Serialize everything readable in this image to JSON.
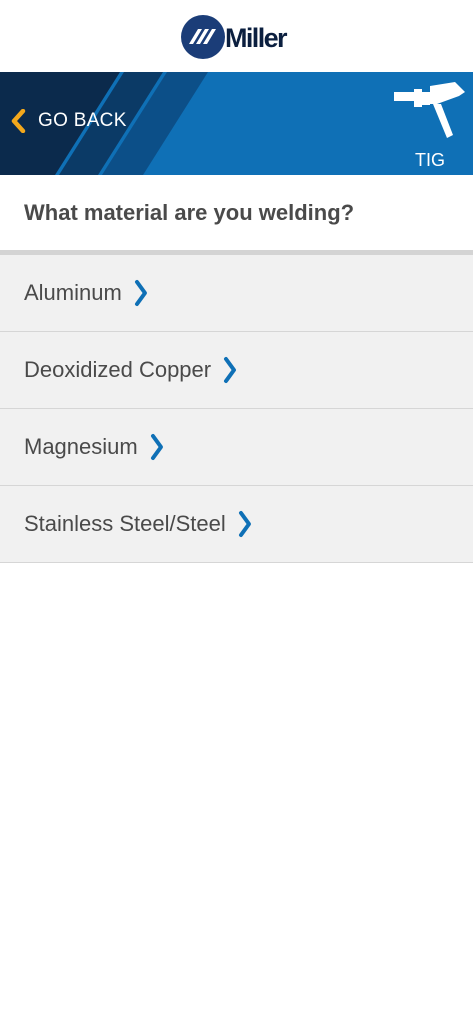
{
  "brand": {
    "name": "Miller",
    "logo_icon": "miller-stripes-circle",
    "colors": {
      "navy": "#1b3d78",
      "blue": "#0f70b6",
      "dark": "#0b2a4c",
      "gold": "#f3a81c"
    }
  },
  "header": {
    "back_label": "GO BACK",
    "back_icon": "chevron-left-icon",
    "process_icon": "tig-torch-icon",
    "process_label": "TIG"
  },
  "question": "What material are you welding?",
  "materials": [
    {
      "label": "Aluminum",
      "icon": "chevron-right-icon"
    },
    {
      "label": "Deoxidized Copper",
      "icon": "chevron-right-icon"
    },
    {
      "label": "Magnesium",
      "icon": "chevron-right-icon"
    },
    {
      "label": "Stainless Steel/Steel",
      "icon": "chevron-right-icon"
    }
  ]
}
